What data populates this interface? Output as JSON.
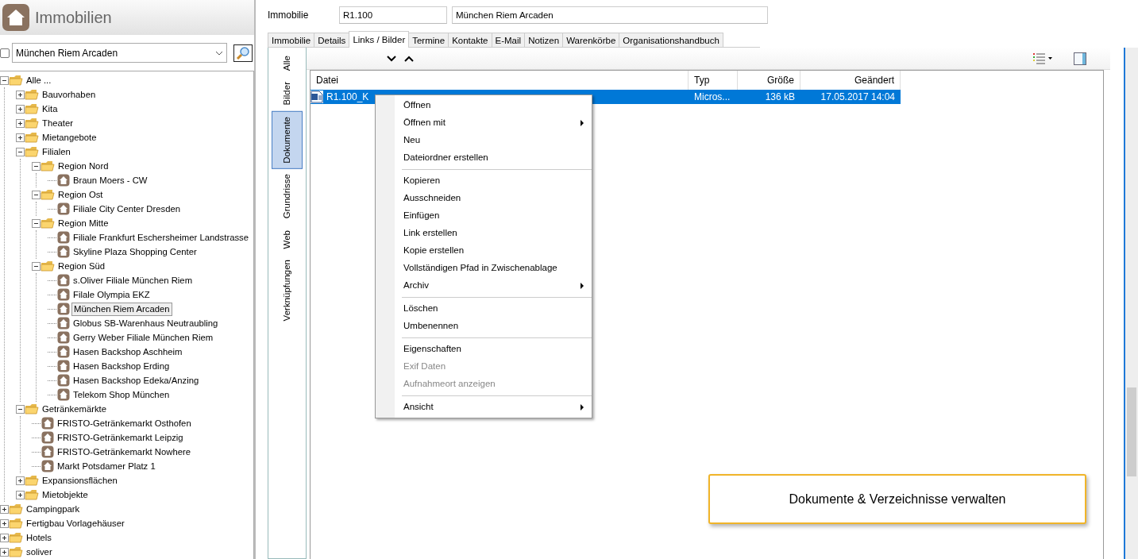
{
  "app": {
    "title": "Immobilien"
  },
  "filter": {
    "checked": false,
    "value": "München Riem Arcaden"
  },
  "tree": [
    {
      "label": "Alle ...",
      "kind": "folder",
      "expanded": true,
      "selected": false,
      "children": [
        {
          "label": "Bauvorhaben",
          "kind": "folder",
          "expanded": false,
          "selected": false
        },
        {
          "label": "Kita",
          "kind": "folder",
          "expanded": false,
          "selected": false
        },
        {
          "label": "Theater",
          "kind": "folder",
          "expanded": false,
          "selected": false
        },
        {
          "label": "Mietangebote",
          "kind": "folder",
          "expanded": false,
          "selected": false
        },
        {
          "label": "Filialen",
          "kind": "folder",
          "expanded": true,
          "selected": false,
          "children": [
            {
              "label": "Region Nord",
              "kind": "folder",
              "expanded": true,
              "selected": false,
              "children": [
                {
                  "label": "Braun Moers - CW",
                  "kind": "property",
                  "selected": false
                }
              ]
            },
            {
              "label": "Region Ost",
              "kind": "folder",
              "expanded": true,
              "selected": false,
              "children": [
                {
                  "label": "Filiale City Center Dresden",
                  "kind": "property",
                  "selected": false
                }
              ]
            },
            {
              "label": "Region Mitte",
              "kind": "folder",
              "expanded": true,
              "selected": false,
              "children": [
                {
                  "label": "Filiale Frankfurt Eschersheimer Landstrasse",
                  "kind": "property",
                  "selected": false
                },
                {
                  "label": "Skyline Plaza Shopping Center",
                  "kind": "property",
                  "selected": false
                }
              ]
            },
            {
              "label": "Region Süd",
              "kind": "folder",
              "expanded": true,
              "selected": false,
              "children": [
                {
                  "label": "s.Oliver Filiale München Riem",
                  "kind": "property",
                  "selected": false
                },
                {
                  "label": "Filale Olympia EKZ",
                  "kind": "property",
                  "selected": false
                },
                {
                  "label": "München Riem Arcaden",
                  "kind": "property",
                  "selected": true
                },
                {
                  "label": "Globus SB-Warenhaus Neutraubling",
                  "kind": "property",
                  "selected": false
                },
                {
                  "label": "Gerry Weber Filiale München Riem",
                  "kind": "property",
                  "selected": false
                },
                {
                  "label": "Hasen Backshop Aschheim",
                  "kind": "property",
                  "selected": false
                },
                {
                  "label": "Hasen Backshop Erding",
                  "kind": "property",
                  "selected": false
                },
                {
                  "label": "Hasen Backshop Edeka/Anzing",
                  "kind": "property",
                  "selected": false
                },
                {
                  "label": "Telekom Shop München",
                  "kind": "property",
                  "selected": false
                }
              ]
            }
          ]
        },
        {
          "label": "Getränkemärkte",
          "kind": "folder",
          "expanded": true,
          "selected": false,
          "children": [
            {
              "label": "FRISTO-Getränkemarkt Osthofen",
              "kind": "property",
              "selected": false
            },
            {
              "label": "FRISTO-Getränkemarkt Leipzig",
              "kind": "property",
              "selected": false
            },
            {
              "label": "FRISTO-Getränkemarkt Nowhere",
              "kind": "property",
              "selected": false
            },
            {
              "label": "Markt Potsdamer Platz 1",
              "kind": "property",
              "selected": false
            }
          ]
        },
        {
          "label": "Expansionsflächen",
          "kind": "folder",
          "expanded": false,
          "selected": false
        },
        {
          "label": "Mietobjekte",
          "kind": "folder",
          "expanded": false,
          "selected": false
        }
      ]
    },
    {
      "label": "Campingpark",
      "kind": "folder",
      "expanded": false,
      "selected": false
    },
    {
      "label": "Fertigbau Vorlagehäuser",
      "kind": "folder",
      "expanded": false,
      "selected": false
    },
    {
      "label": "Hotels",
      "kind": "folder",
      "expanded": false,
      "selected": false
    },
    {
      "label": "soliver",
      "kind": "folder",
      "expanded": false,
      "selected": false
    }
  ],
  "property": {
    "label": "Immobilie",
    "code": "R1.100",
    "name": "München Riem Arcaden"
  },
  "tabs": [
    {
      "label": "Immobilie",
      "selected": false
    },
    {
      "label": "Details",
      "selected": false
    },
    {
      "label": "Links / Bilder",
      "selected": true
    },
    {
      "label": "Termine",
      "selected": false
    },
    {
      "label": "Kontakte",
      "selected": false
    },
    {
      "label": "E-Mail",
      "selected": false
    },
    {
      "label": "Notizen",
      "selected": false
    },
    {
      "label": "Warenkörbe",
      "selected": false
    },
    {
      "label": "Organisationshandbuch",
      "selected": false
    }
  ],
  "side_tabs": [
    {
      "label": "Alle",
      "selected": false
    },
    {
      "label": "Bilder",
      "selected": false
    },
    {
      "label": "Dokumente",
      "selected": true
    },
    {
      "label": "Grundrisse",
      "selected": false
    },
    {
      "label": "Web",
      "selected": false
    },
    {
      "label": "Verknüpfungen",
      "selected": false
    }
  ],
  "table": {
    "columns": [
      "Datei",
      "Typ",
      "Größe",
      "Geändert"
    ],
    "rows": [
      {
        "selected": true,
        "cells": [
          "R1.100_K",
          "Micros...",
          "136 kB",
          "17.05.2017 14:04"
        ]
      }
    ]
  },
  "context_menu": {
    "groups": [
      [
        {
          "label": "Öffnen",
          "disabled": false,
          "submenu": false
        },
        {
          "label": "Öffnen mit",
          "disabled": false,
          "submenu": true
        },
        {
          "label": "Neu",
          "disabled": false,
          "submenu": false
        },
        {
          "label": "Dateiordner erstellen",
          "disabled": false,
          "submenu": false
        }
      ],
      [
        {
          "label": "Kopieren",
          "disabled": false,
          "submenu": false
        },
        {
          "label": "Ausschneiden",
          "disabled": false,
          "submenu": false
        },
        {
          "label": "Einfügen",
          "disabled": false,
          "submenu": false
        },
        {
          "label": "Link erstellen",
          "disabled": false,
          "submenu": false
        },
        {
          "label": "Kopie erstellen",
          "disabled": false,
          "submenu": false
        },
        {
          "label": "Vollständigen Pfad in Zwischenablage",
          "disabled": false,
          "submenu": false
        },
        {
          "label": "Archiv",
          "disabled": false,
          "submenu": true
        }
      ],
      [
        {
          "label": "Löschen",
          "disabled": false,
          "submenu": false
        },
        {
          "label": "Umbenennen",
          "disabled": false,
          "submenu": false
        }
      ],
      [
        {
          "label": "Eigenschaften",
          "disabled": false,
          "submenu": false
        },
        {
          "label": "Exif Daten",
          "disabled": true,
          "submenu": false
        },
        {
          "label": "Aufnahmeort anzeigen",
          "disabled": true,
          "submenu": false
        }
      ],
      [
        {
          "label": "Ansicht",
          "disabled": false,
          "submenu": true
        }
      ]
    ]
  },
  "callout": {
    "text": "Dokumente & Verzeichnisse verwalten"
  }
}
